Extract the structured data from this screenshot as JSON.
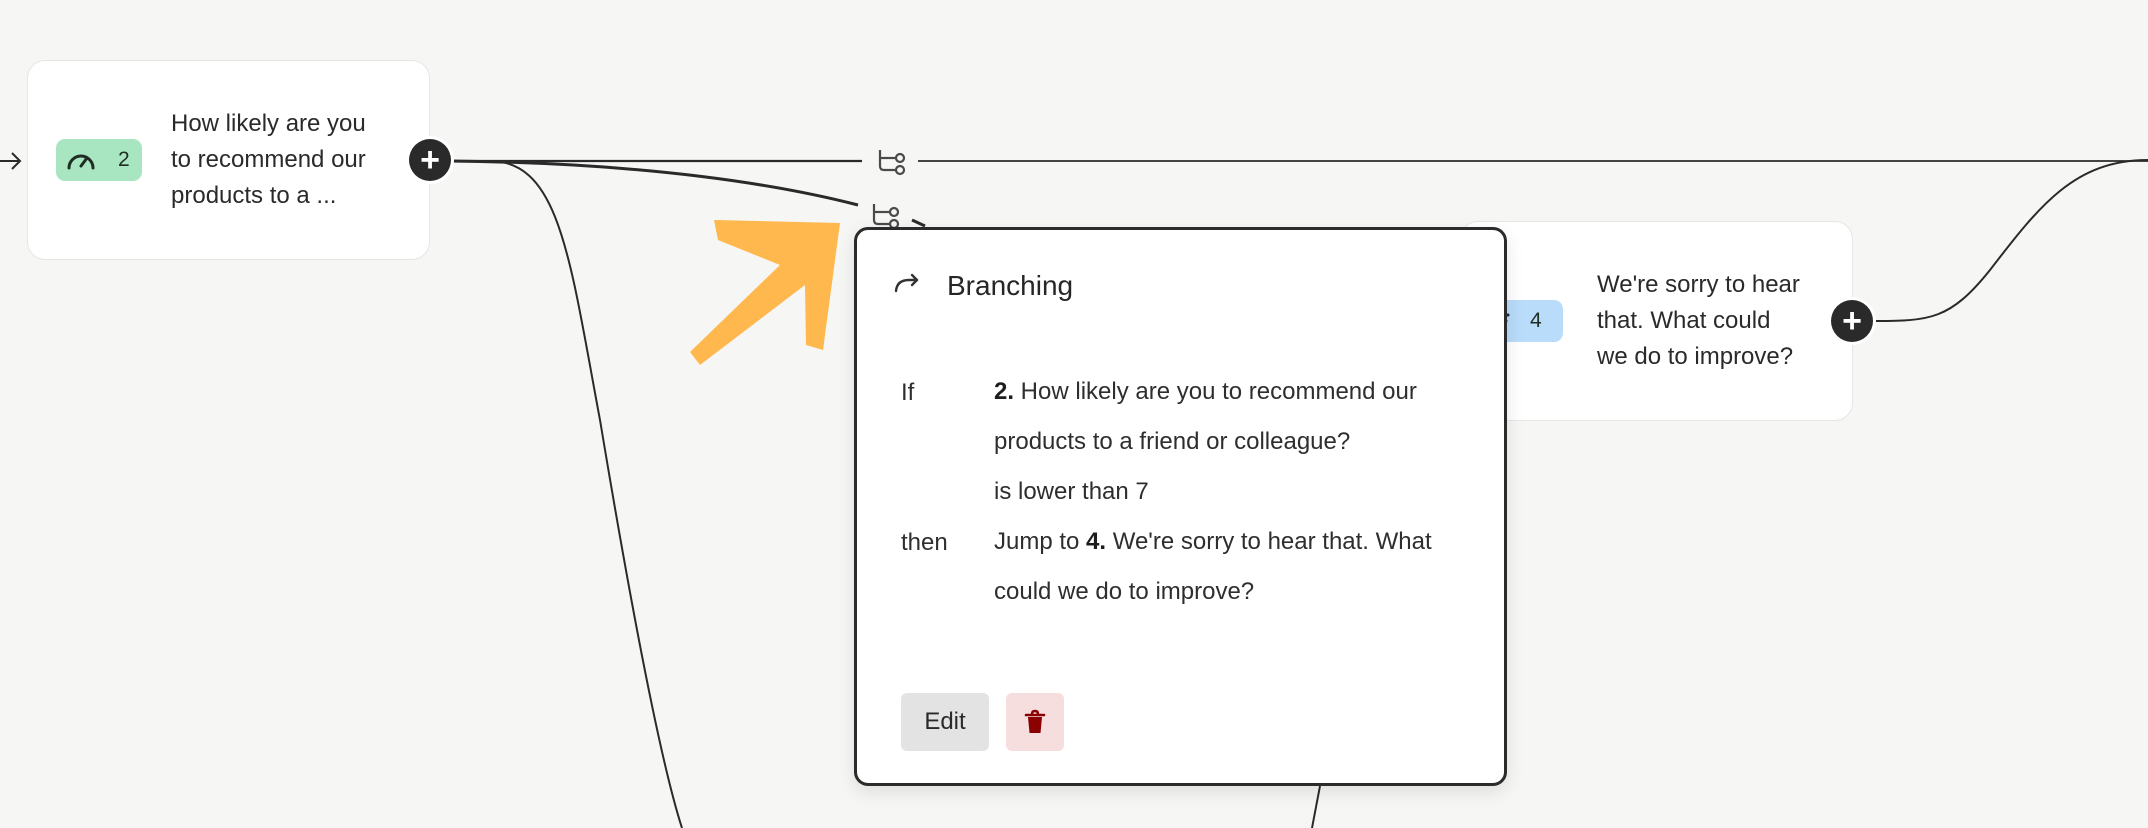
{
  "nodes": [
    {
      "id": "q2",
      "number": "2",
      "text": "How likely are you\nto recommend our\nproducts to a ...",
      "badge_color": "#a8e6c1",
      "badge_icon": "gauge-icon"
    },
    {
      "id": "q4",
      "number": "4",
      "text": "We're sorry to hear\nthat. What could\nwe do to improve?",
      "badge_color": "#b9dcfb",
      "badge_icon": "text-lines-icon"
    }
  ],
  "popover": {
    "title": "Branching",
    "if_label": "If",
    "condition_number": "2.",
    "condition_question": " How likely are you to recommend our products to a friend or colleague?",
    "condition_rule": "is lower than 7",
    "then_label": "then",
    "action_prefix": "Jump to ",
    "target_number": "4.",
    "target_question": " We're sorry to hear that. What could we do to improve?",
    "edit_label": "Edit",
    "delete_icon": "trash-icon"
  },
  "colors": {
    "canvas": "#f6f6f4",
    "accent_arrow": "#ffb84d",
    "delete_red": "#8b0000",
    "delete_bg": "#f6dede"
  }
}
